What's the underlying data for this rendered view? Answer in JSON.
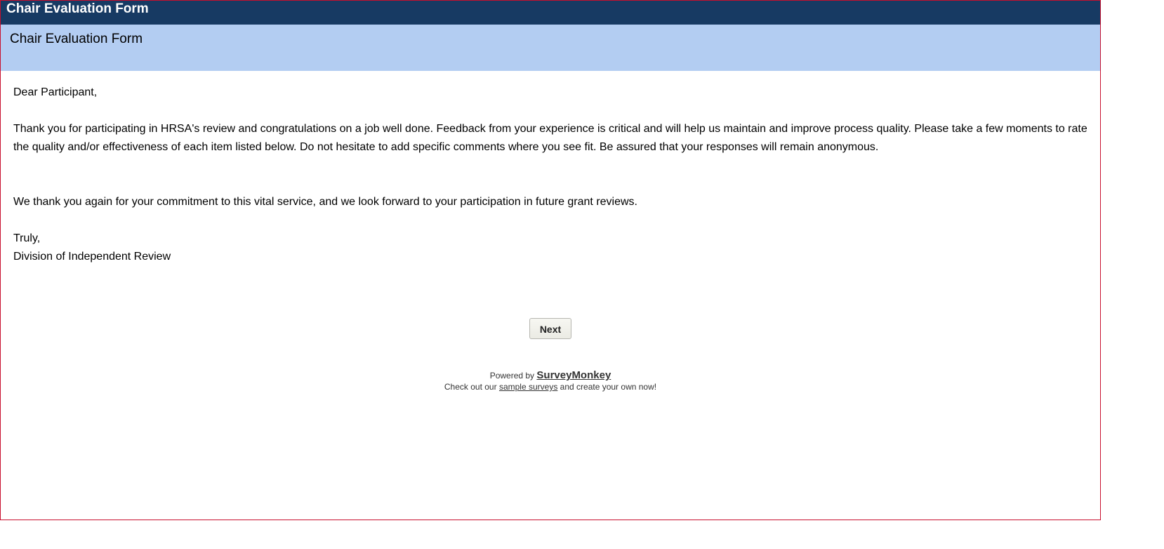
{
  "window": {
    "title": "Chair Evaluation Form"
  },
  "page": {
    "header": "Chair Evaluation Form"
  },
  "letter": {
    "greeting": "Dear Participant,",
    "paragraph1": "Thank you for participating in HRSA's review and congratulations on a job well done. Feedback from your experience is critical and will help us maintain and improve process quality. Please take a few moments to rate the quality and/or effectiveness of each item listed below. Do not hesitate to add specific comments where you see fit. Be assured that your responses will remain anonymous.",
    "paragraph2": "We thank you again for your commitment to this vital service, and we look forward to your participation in future grant reviews.",
    "closing": "Truly,",
    "signature": "Division of Independent Review"
  },
  "nav": {
    "next_label": "Next"
  },
  "footer": {
    "powered_by": "Powered by",
    "brand": "SurveyMonkey",
    "check_out": "Check out our",
    "sample_link": "sample surveys",
    "create_text": "and create your own now!"
  },
  "colors": {
    "title_bar_bg": "#173a63",
    "header_bg": "#b3cdf2",
    "frame_border": "#c8102e"
  }
}
